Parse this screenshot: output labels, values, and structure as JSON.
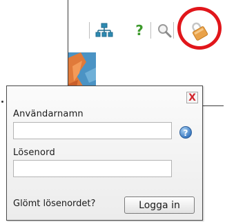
{
  "toolbar": {
    "icons": [
      "sitemap-icon",
      "help-icon",
      "search-icon",
      "login-lock-icon"
    ],
    "help_glyph": "?"
  },
  "login": {
    "username_label": "Användarnamn",
    "username_value": "",
    "password_label": "Lösenord",
    "password_value": "",
    "forgot_label": "Glömt lösenordet?",
    "submit_label": "Logga in",
    "close_glyph": "X",
    "info_glyph": "?"
  },
  "colors": {
    "highlight_ring": "#e1161b",
    "close_x": "#d2262d",
    "info_button": "#3e7cc3",
    "help_icon": "#3d9a2c",
    "sitemap_icon": "#2e8ab2",
    "lock_icon": "#e9a24a"
  }
}
